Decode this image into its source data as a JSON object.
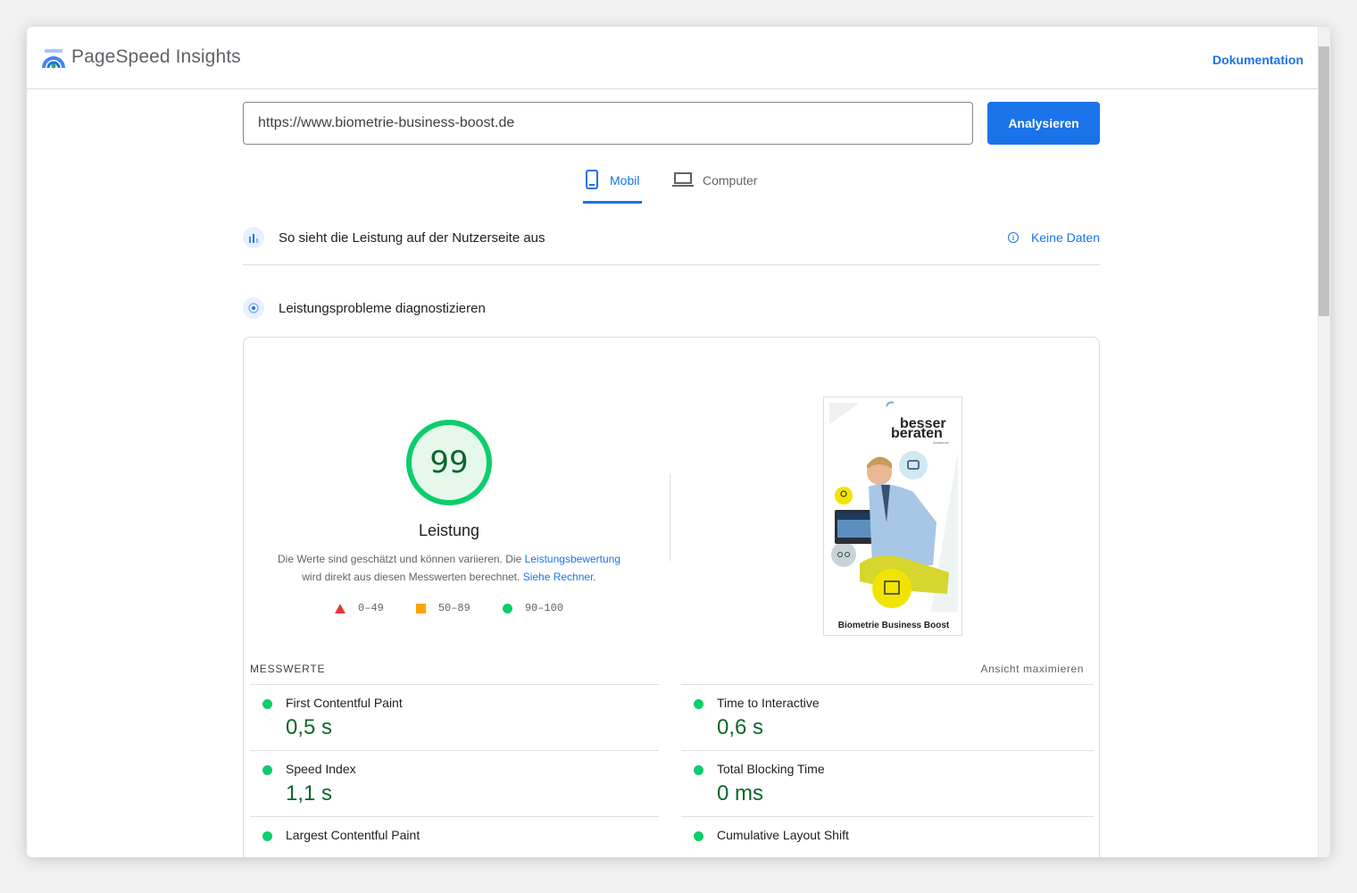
{
  "header": {
    "title": "PageSpeed Insights",
    "doc_link": "Dokumentation"
  },
  "search": {
    "url": "https://www.biometrie-business-boost.de",
    "button": "Analysieren"
  },
  "device_tabs": [
    {
      "label": "Mobil",
      "selected": true
    },
    {
      "label": "Computer",
      "selected": false
    }
  ],
  "field_data": {
    "title": "So sieht die Leistung auf der Nutzerseite aus",
    "status": "Keine Daten"
  },
  "lab": {
    "title": "Leistungsprobleme diagnostizieren",
    "score": "99",
    "score_label": "Leistung",
    "desc_1": "Die Werte sind geschätzt und können variieren. Die ",
    "desc_link_1": "Leistungsbewertung",
    "desc_2": "wird direkt aus diesen Messwerten berechnet. ",
    "desc_link_2": "Siehe Rechner.",
    "legend": [
      "0–49",
      "50–89",
      "90–100"
    ],
    "colors": {
      "fail": "#e53935",
      "average": "#ffa400",
      "pass": "#0cce6b",
      "pass_text": "#0d652d"
    }
  },
  "screenshot": {
    "brand_1": "besser",
    "brand_2": "beraten",
    "brand_sub": "Akademie",
    "caption": "Biometrie Business Boost"
  },
  "metrics": {
    "heading": "MESSWERTE",
    "expand": "Ansicht maximieren",
    "items": [
      {
        "name": "First Contentful Paint",
        "value": "0,5 s"
      },
      {
        "name": "Time to Interactive",
        "value": "0,6 s"
      },
      {
        "name": "Speed Index",
        "value": "1,1 s"
      },
      {
        "name": "Total Blocking Time",
        "value": "0 ms"
      },
      {
        "name": "Largest Contentful Paint",
        "value": ""
      },
      {
        "name": "Cumulative Layout Shift",
        "value": ""
      }
    ]
  }
}
